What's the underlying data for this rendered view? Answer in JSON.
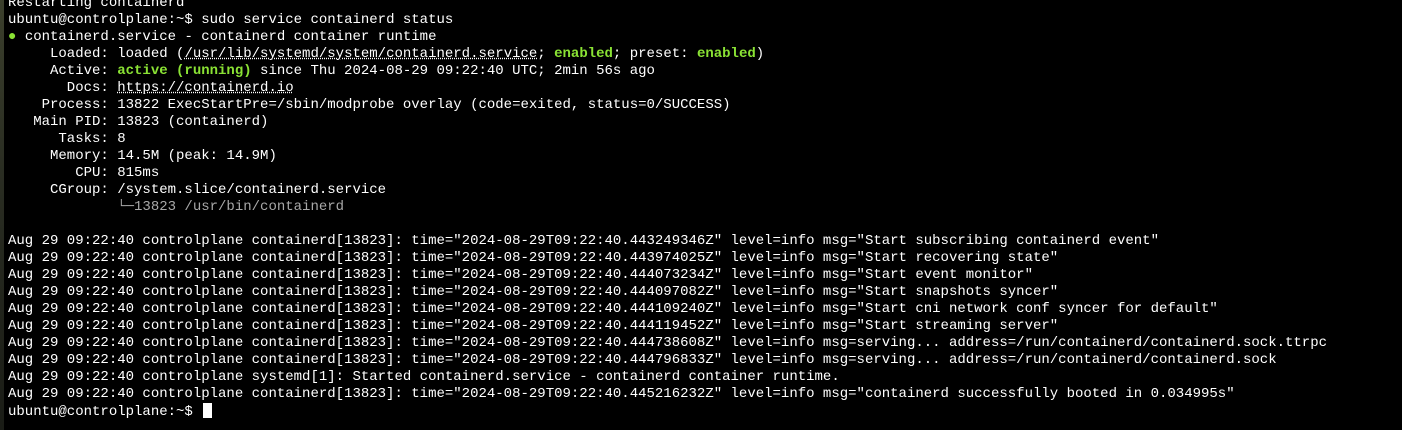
{
  "terminal": {
    "prev_line": "Restarting containerd",
    "prompt_user": "ubuntu@controlplane:~$",
    "command": "sudo service containerd status",
    "status_dot": "●",
    "unit_title": "containerd.service - containerd container runtime",
    "loaded": {
      "label": "     Loaded: ",
      "prefix": "loaded (",
      "path": "/usr/lib/systemd/system/containerd.service",
      "sep1": "; ",
      "enabled": "enabled",
      "sep2": "; preset: ",
      "preset": "enabled",
      "suffix": ")"
    },
    "active": {
      "label": "     Active: ",
      "state": "active (running)",
      "rest": " since Thu 2024-08-29 09:22:40 UTC; 2min 56s ago"
    },
    "docs": {
      "label": "       Docs: ",
      "url": "https://containerd.io"
    },
    "process": "    Process: 13822 ExecStartPre=/sbin/modprobe overlay (code=exited, status=0/SUCCESS)",
    "main_pid": "   Main PID: 13823 (containerd)",
    "tasks": "      Tasks: 8",
    "memory": "     Memory: 14.5M (peak: 14.9M)",
    "cpu": "        CPU: 815ms",
    "cgroup": "     CGroup: /system.slice/containerd.service",
    "cgroup_child_prefix": "             ",
    "cgroup_child": "└─13823 /usr/bin/containerd",
    "logs": [
      "Aug 29 09:22:40 controlplane containerd[13823]: time=\"2024-08-29T09:22:40.443249346Z\" level=info msg=\"Start subscribing containerd event\"",
      "Aug 29 09:22:40 controlplane containerd[13823]: time=\"2024-08-29T09:22:40.443974025Z\" level=info msg=\"Start recovering state\"",
      "Aug 29 09:22:40 controlplane containerd[13823]: time=\"2024-08-29T09:22:40.444073234Z\" level=info msg=\"Start event monitor\"",
      "Aug 29 09:22:40 controlplane containerd[13823]: time=\"2024-08-29T09:22:40.444097082Z\" level=info msg=\"Start snapshots syncer\"",
      "Aug 29 09:22:40 controlplane containerd[13823]: time=\"2024-08-29T09:22:40.444109240Z\" level=info msg=\"Start cni network conf syncer for default\"",
      "Aug 29 09:22:40 controlplane containerd[13823]: time=\"2024-08-29T09:22:40.444119452Z\" level=info msg=\"Start streaming server\"",
      "Aug 29 09:22:40 controlplane containerd[13823]: time=\"2024-08-29T09:22:40.444738608Z\" level=info msg=serving... address=/run/containerd/containerd.sock.ttrpc",
      "Aug 29 09:22:40 controlplane containerd[13823]: time=\"2024-08-29T09:22:40.444796833Z\" level=info msg=serving... address=/run/containerd/containerd.sock",
      "Aug 29 09:22:40 controlplane systemd[1]: Started containerd.service - containerd container runtime.",
      "Aug 29 09:22:40 controlplane containerd[13823]: time=\"2024-08-29T09:22:40.445216232Z\" level=info msg=\"containerd successfully booted in 0.034995s\""
    ],
    "final_prompt": "ubuntu@controlplane:~$ "
  },
  "colors": {
    "background": "#000000",
    "foreground": "#ffffff",
    "accent_green": "#8ae234",
    "dim_gray": "#a8a8a8"
  }
}
